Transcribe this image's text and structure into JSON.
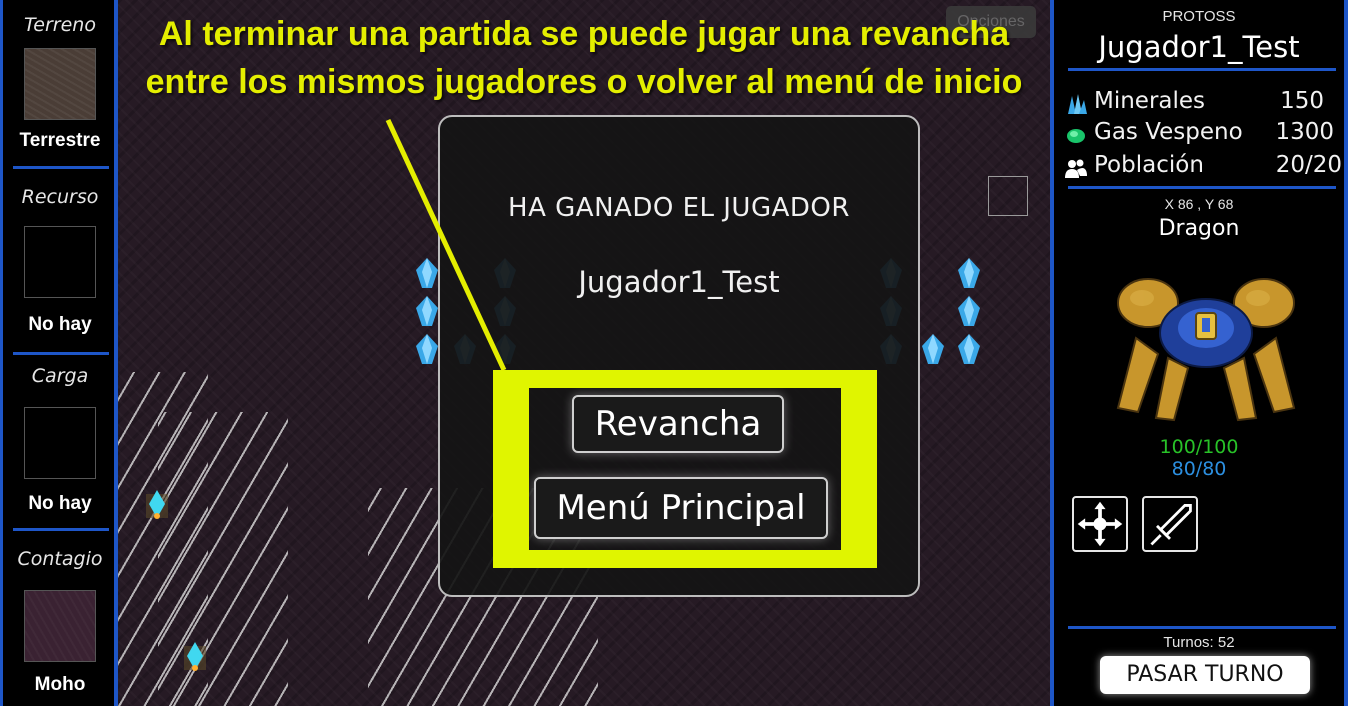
{
  "left_panel": {
    "terrain": {
      "title": "Terreno",
      "value": "Terrestre",
      "swatch_color": "#4a3d36"
    },
    "resource": {
      "title": "Recurso",
      "value": "No hay",
      "swatch_color": "#000000"
    },
    "cargo": {
      "title": "Carga",
      "value": "No hay",
      "swatch_color": "#000000"
    },
    "contagion": {
      "title": "Contagio",
      "value": "Moho",
      "swatch_color": "#3a2232"
    }
  },
  "map": {
    "options_label": "Opciones"
  },
  "annotation": {
    "line1": "Al terminar una partida se puede jugar una revancha",
    "line2": "entre los mismos jugadores o volver al menú de inicio",
    "color": "#e4ee00"
  },
  "dialog": {
    "title": "HA GANADO EL JUGADOR",
    "player": "Jugador1_Test",
    "rematch_label": "Revancha",
    "menu_label": "Menú Principal"
  },
  "right_panel": {
    "race": "PROTOSS",
    "player_name": "Jugador1_Test",
    "resources": [
      {
        "label": "Minerales",
        "value": "150",
        "icon": "mineral-icon"
      },
      {
        "label": "Gas Vespeno",
        "value": "1300",
        "icon": "gas-icon"
      },
      {
        "label": "Población",
        "value": "20/20",
        "icon": "population-icon"
      }
    ],
    "coords": "X 86 , Y 68",
    "unit_name": "Dragon",
    "hp": "100/100",
    "shield": "80/80",
    "actions": [
      {
        "name": "move-icon"
      },
      {
        "name": "sword-icon"
      }
    ],
    "turns": "Turnos: 52",
    "end_turn_label": "PASAR TURNO"
  }
}
